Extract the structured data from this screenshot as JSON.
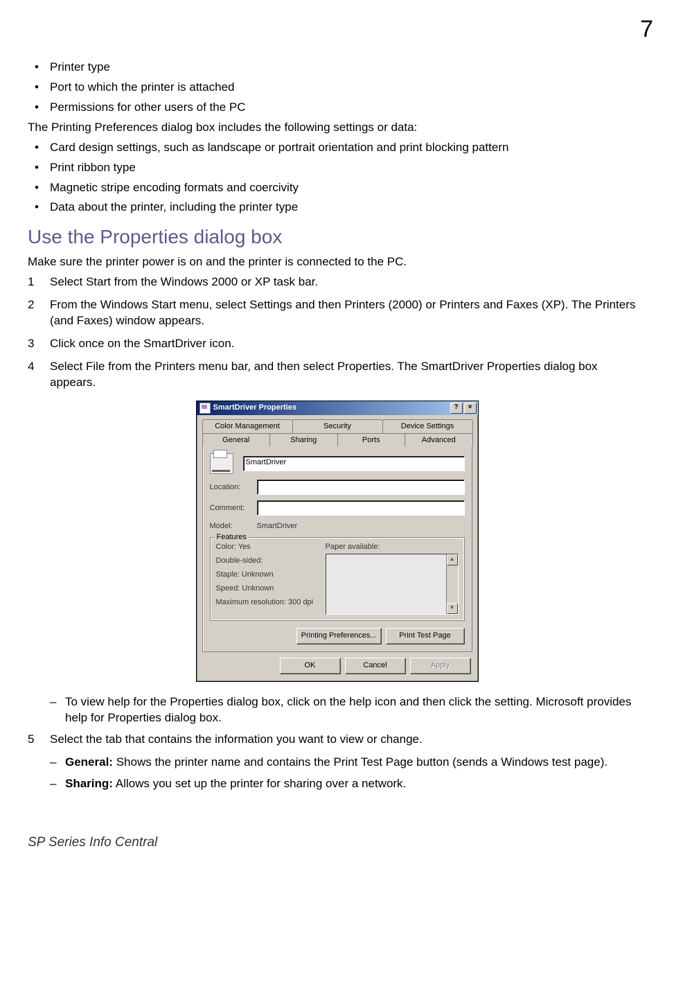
{
  "page_number": "7",
  "top_bullets": [
    "Printer type",
    "Port to which the printer is attached",
    "Permissions for other users of the PC"
  ],
  "intro_para": "The Printing Preferences dialog box includes the following settings or data:",
  "pref_bullets": [
    "Card design settings, such as landscape or portrait orientation and print blocking pattern",
    "Print ribbon type",
    "Magnetic stripe encoding formats and coercivity",
    "Data about the printer, including the printer type"
  ],
  "section_heading": "Use the Properties dialog box",
  "section_intro": "Make sure the printer power is on and the printer is connected to the PC.",
  "steps": [
    "Select Start from the Windows 2000 or XP task bar.",
    "From the Windows Start menu, select Settings and then Printers (2000) or Printers and Faxes (XP). The Printers (and Faxes) window appears.",
    "Click once on the SmartDriver icon.",
    "Select File from the Printers menu bar, and then select Properties. The SmartDriver Properties dialog box appears."
  ],
  "sub_after_dialog": "To view help for the Properties dialog box, click on the help icon and then click the setting. Microsoft provides help for Properties dialog box.",
  "step5": "Select the tab that contains the information you want to view or change.",
  "tab_descriptions": [
    {
      "bold": "General:",
      "rest": " Shows the printer name and contains the Print Test Page button (sends a Windows test page)."
    },
    {
      "bold": "Sharing:",
      "rest": " Allows you set up the printer for sharing over a network."
    }
  ],
  "footer": "SP Series Info Central",
  "dialog": {
    "title": "SmartDriver Properties",
    "help_btn": "?",
    "close_btn": "×",
    "tabs_back": [
      "Color Management",
      "Security",
      "Device Settings"
    ],
    "tabs_front": [
      "General",
      "Sharing",
      "Ports",
      "Advanced"
    ],
    "name_value": "SmartDriver",
    "location_label": "Location:",
    "location_value": "",
    "comment_label": "Comment:",
    "comment_value": "",
    "model_label": "Model:",
    "model_value": "SmartDriver",
    "features_legend": "Features",
    "features_left": [
      "Color: Yes",
      "Double-sided:",
      "Staple: Unknown",
      "Speed: Unknown",
      "Maximum resolution: 300 dpi"
    ],
    "paper_label": "Paper available:",
    "btn_prefs": "Printing Preferences...",
    "btn_test": "Print Test Page",
    "btn_ok": "OK",
    "btn_cancel": "Cancel",
    "btn_apply": "Apply"
  }
}
